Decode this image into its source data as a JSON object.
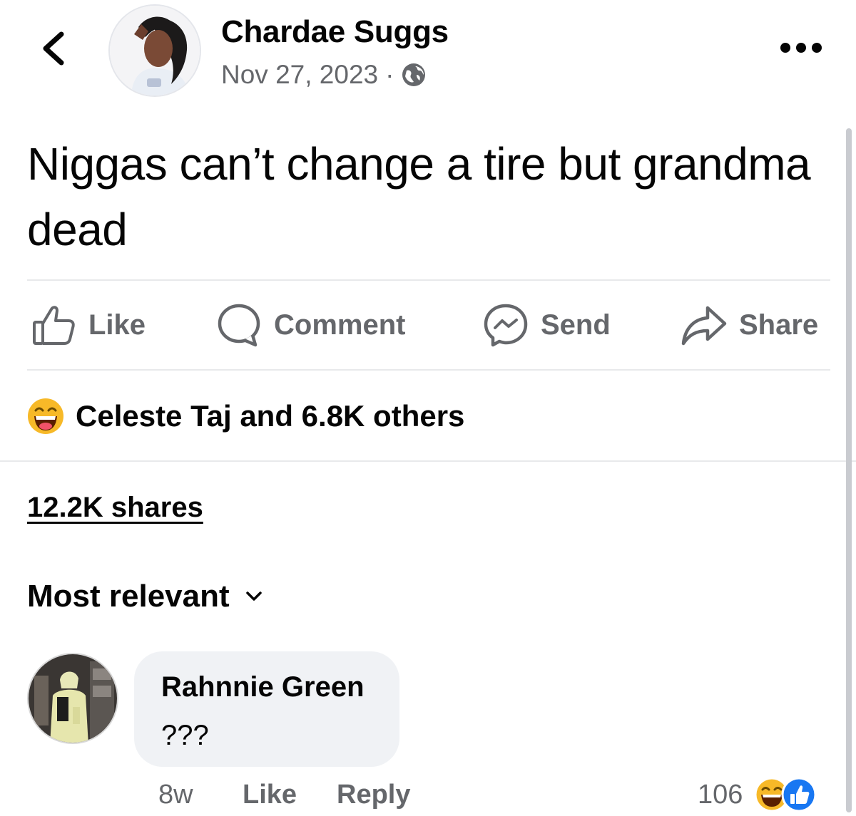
{
  "post": {
    "author": "Chardae Suggs",
    "date": "Nov 27, 2023",
    "separator": "·",
    "text": "Niggas can’t change a tire but grandma dead"
  },
  "icons": {
    "back": "chevron-left-icon",
    "audience": "globe-icon",
    "more": "more-options-icon"
  },
  "actions": {
    "like": "Like",
    "comment": "Comment",
    "send": "Send",
    "share": "Share"
  },
  "reactions": {
    "summary": "Celeste Taj and 6.8K others"
  },
  "shares": "12.2K shares",
  "sort": {
    "label": "Most relevant"
  },
  "comment": {
    "author": "Rahnnie Green",
    "text": "???",
    "time": "8w",
    "like": "Like",
    "reply": "Reply",
    "reaction_count": "106"
  },
  "colors": {
    "text": "#050505",
    "secondary": "#65676b",
    "bubble": "#f0f2f5",
    "divider": "#e8e9eb",
    "like_blue": "#1877f2",
    "haha_yellow": "#f7b928"
  }
}
